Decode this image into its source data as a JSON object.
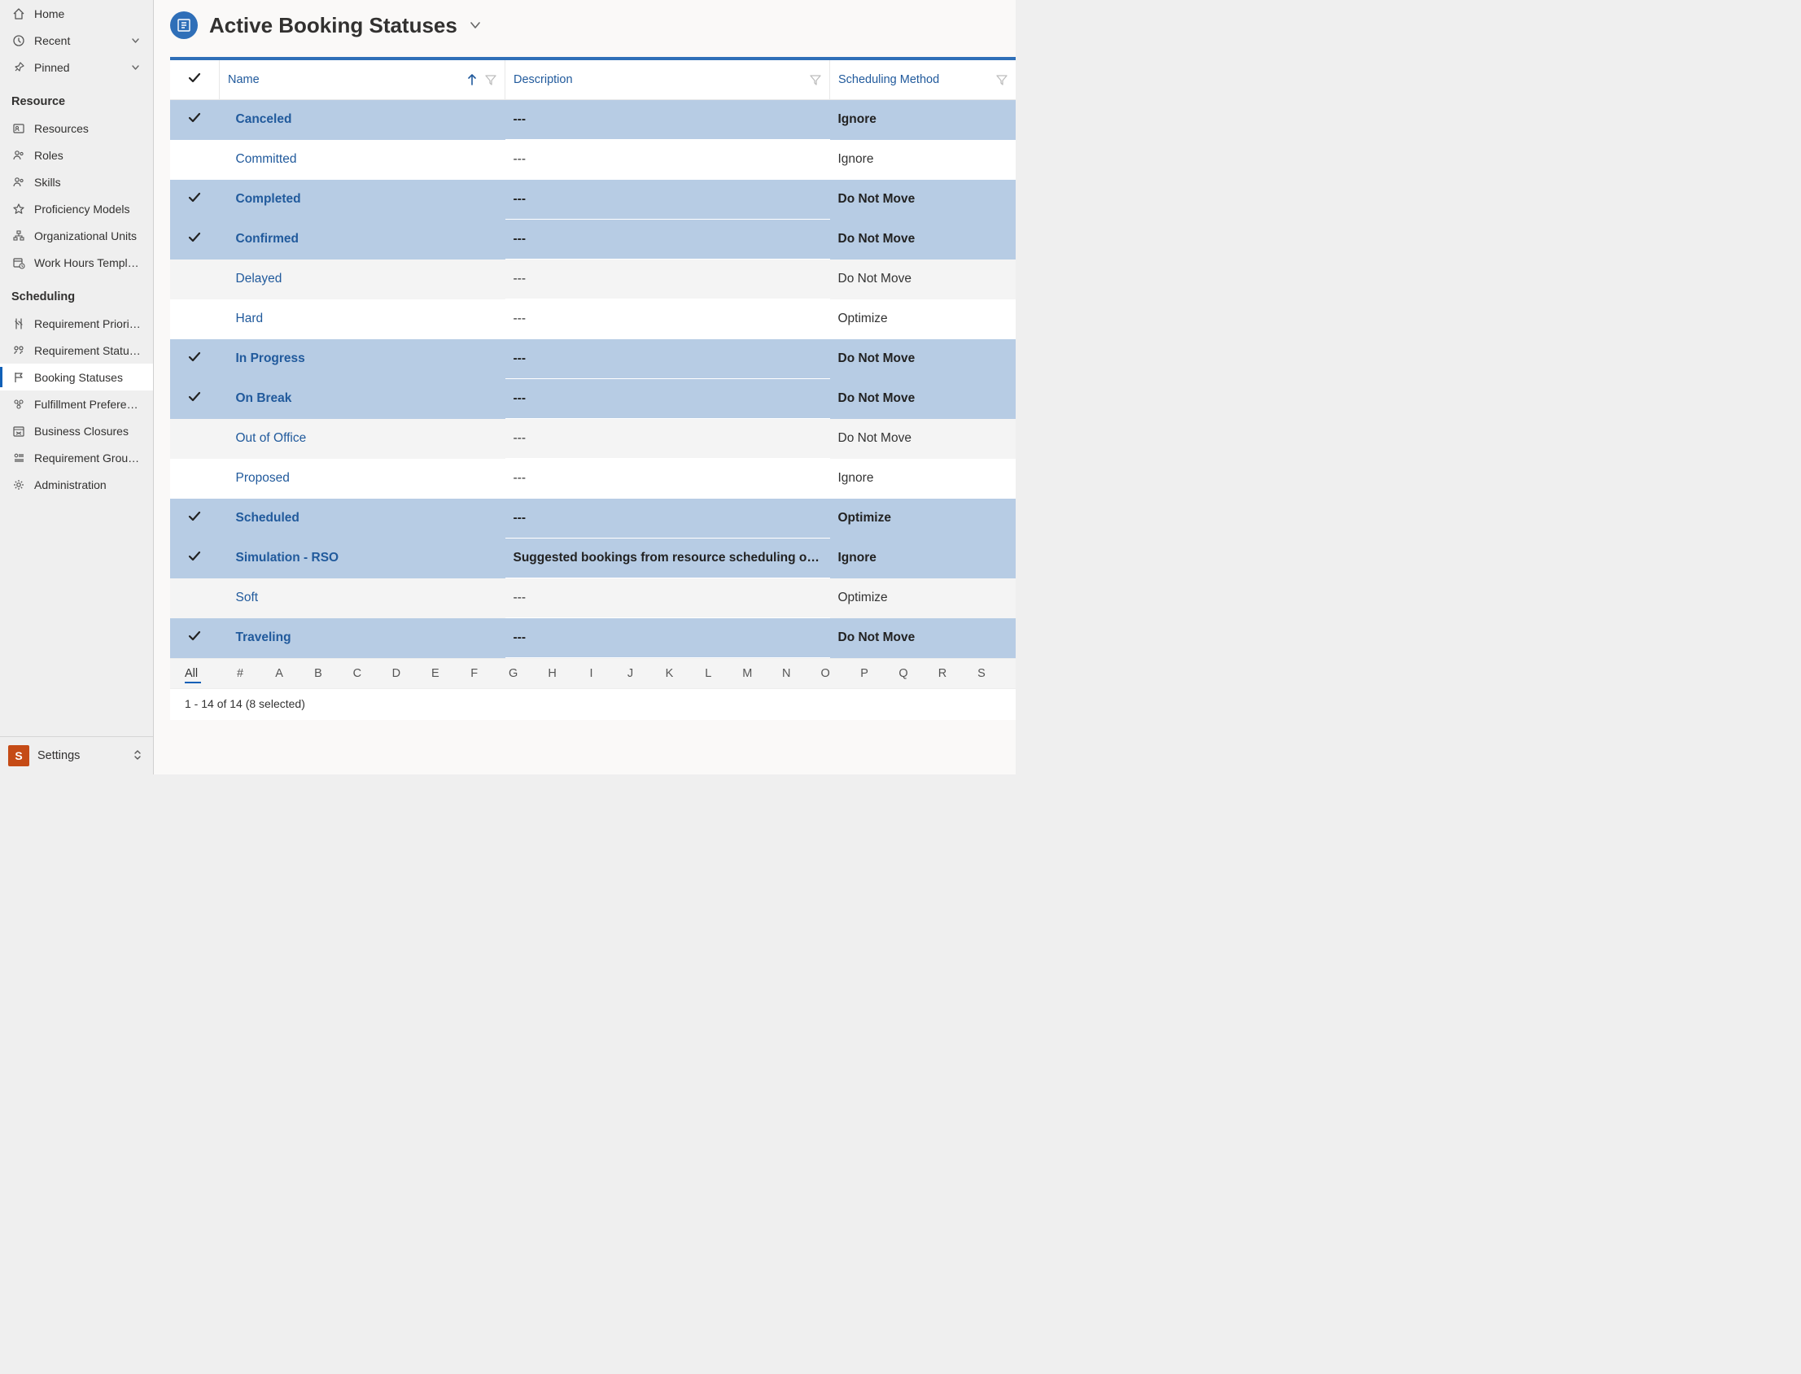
{
  "sidebar": {
    "top": [
      {
        "label": "Home",
        "icon": "home-icon"
      },
      {
        "label": "Recent",
        "icon": "clock-icon",
        "chevron": true
      },
      {
        "label": "Pinned",
        "icon": "pin-icon",
        "chevron": true
      }
    ],
    "sections": [
      {
        "header": "Resource",
        "items": [
          {
            "label": "Resources",
            "icon": "resources-icon"
          },
          {
            "label": "Roles",
            "icon": "roles-icon"
          },
          {
            "label": "Skills",
            "icon": "skills-icon"
          },
          {
            "label": "Proficiency Models",
            "icon": "star-icon"
          },
          {
            "label": "Organizational Units",
            "icon": "org-icon"
          },
          {
            "label": "Work Hours Templates",
            "icon": "workhours-icon"
          }
        ]
      },
      {
        "header": "Scheduling",
        "items": [
          {
            "label": "Requirement Priorities",
            "icon": "priority-icon"
          },
          {
            "label": "Requirement Statuses",
            "icon": "reqstatus-icon"
          },
          {
            "label": "Booking Statuses",
            "icon": "flag-icon",
            "active": true
          },
          {
            "label": "Fulfillment Preferences",
            "icon": "fulfill-icon"
          },
          {
            "label": "Business Closures",
            "icon": "closure-icon"
          },
          {
            "label": "Requirement Group …",
            "icon": "reqgroup-icon"
          },
          {
            "label": "Administration",
            "icon": "gear-icon"
          }
        ]
      }
    ],
    "footer": {
      "badge": "S",
      "label": "Settings"
    }
  },
  "header": {
    "title": "Active Booking Statuses"
  },
  "grid": {
    "columns": {
      "name": "Name",
      "desc": "Description",
      "method": "Scheduling Method"
    },
    "rows": [
      {
        "selected": true,
        "name": "Canceled",
        "desc": "---",
        "method": "Ignore"
      },
      {
        "selected": false,
        "name": "Committed",
        "desc": "---",
        "method": "Ignore"
      },
      {
        "selected": true,
        "name": "Completed",
        "desc": "---",
        "method": "Do Not Move"
      },
      {
        "selected": true,
        "name": "Confirmed",
        "desc": "---",
        "method": "Do Not Move"
      },
      {
        "selected": false,
        "alt": true,
        "name": "Delayed",
        "desc": "---",
        "method": "Do Not Move"
      },
      {
        "selected": false,
        "name": "Hard",
        "desc": "---",
        "method": "Optimize"
      },
      {
        "selected": true,
        "name": "In Progress",
        "desc": "---",
        "method": "Do Not Move"
      },
      {
        "selected": true,
        "name": "On Break",
        "desc": "---",
        "method": "Do Not Move"
      },
      {
        "selected": false,
        "alt": true,
        "name": "Out of Office",
        "desc": "---",
        "method": "Do Not Move"
      },
      {
        "selected": false,
        "name": "Proposed",
        "desc": "---",
        "method": "Ignore"
      },
      {
        "selected": true,
        "name": "Scheduled",
        "desc": "---",
        "method": "Optimize"
      },
      {
        "selected": true,
        "name": "Simulation - RSO",
        "desc": "Suggested bookings from resource scheduling optimiz…",
        "method": "Ignore"
      },
      {
        "selected": false,
        "alt": true,
        "name": "Soft",
        "desc": "---",
        "method": "Optimize"
      },
      {
        "selected": true,
        "name": "Traveling",
        "desc": "---",
        "method": "Do Not Move"
      }
    ]
  },
  "alpha": [
    "All",
    "#",
    "A",
    "B",
    "C",
    "D",
    "E",
    "F",
    "G",
    "H",
    "I",
    "J",
    "K",
    "L",
    "M",
    "N",
    "O",
    "P",
    "Q",
    "R",
    "S"
  ],
  "footer": {
    "status": "1 - 14 of 14 (8 selected)"
  }
}
